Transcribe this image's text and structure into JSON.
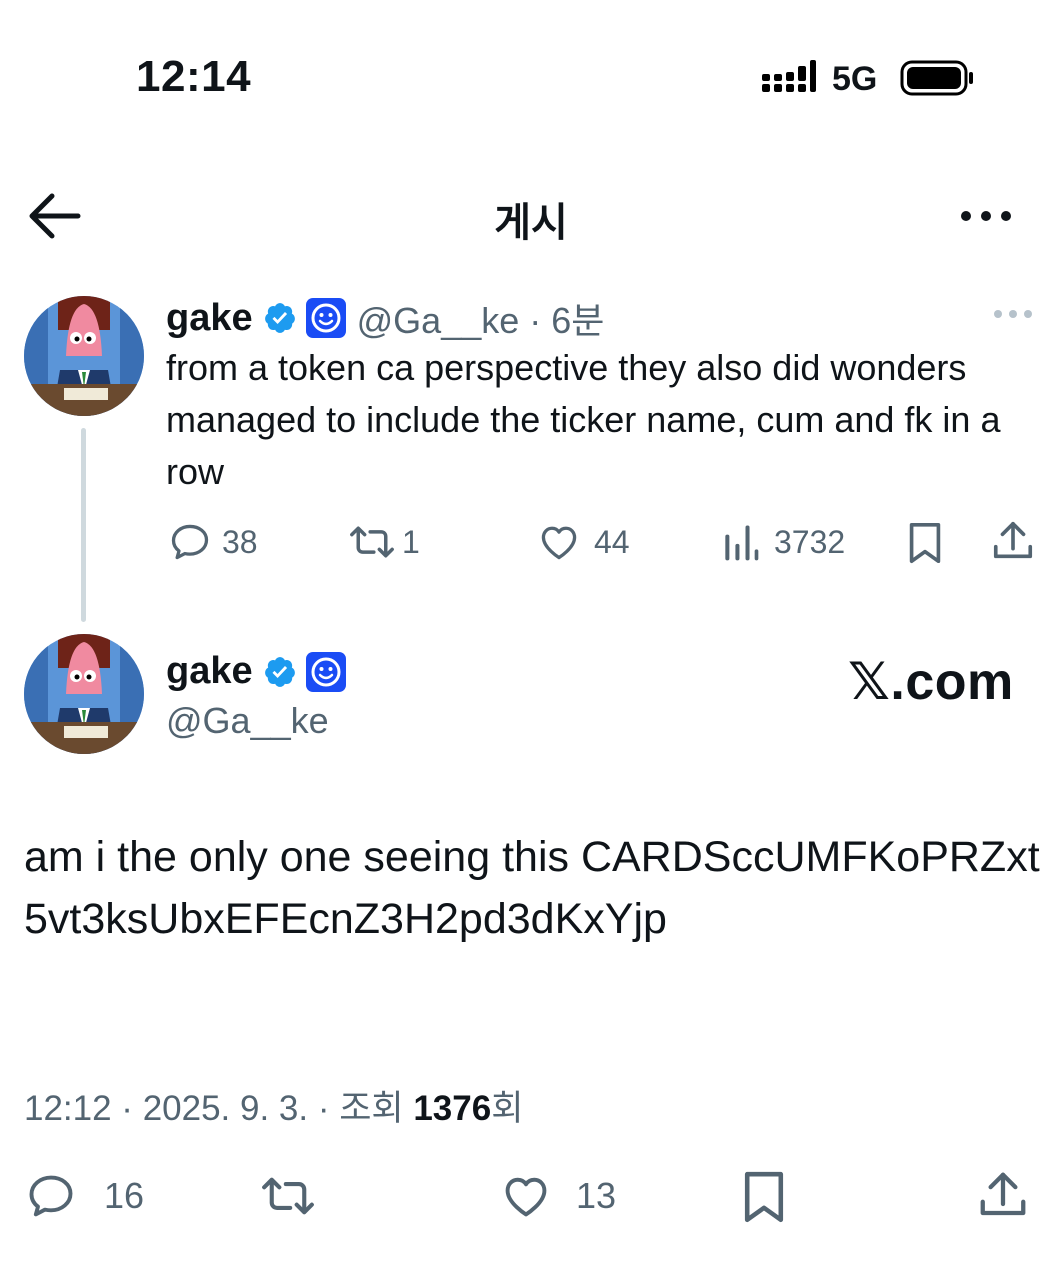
{
  "status_bar": {
    "time": "12:14",
    "network": "5G"
  },
  "nav": {
    "title": "게시",
    "back_icon": "arrow-left-icon",
    "more_icon": "more-horizontal-icon"
  },
  "reply_tweet": {
    "name": "gake",
    "handle_time": "@Ga__ke · 6분",
    "text": "from a token ca perspective they also did wonders managed to include the ticker name, cum and fk in a row",
    "actions": {
      "replies": "38",
      "retweets": "1",
      "likes": "44",
      "views": "3732"
    }
  },
  "main_tweet": {
    "name": "gake",
    "handle": "@Ga__ke",
    "source_label": "𝕏.com",
    "text": "am i the only one seeing this CARDSccUMFKoPRZxt5vt3ksUbxEFEcnZ3H2pd3dKxYjp",
    "meta_prefix": "12:12 · 2025. 9. 3. · 조회 ",
    "views": "1376",
    "meta_suffix": "회",
    "actions": {
      "replies": "16",
      "likes": "13"
    }
  },
  "colors": {
    "verified": "#1d9bf0",
    "affiliation": "#1a4cf5",
    "text": "#0f1419",
    "secondary": "#536471"
  }
}
